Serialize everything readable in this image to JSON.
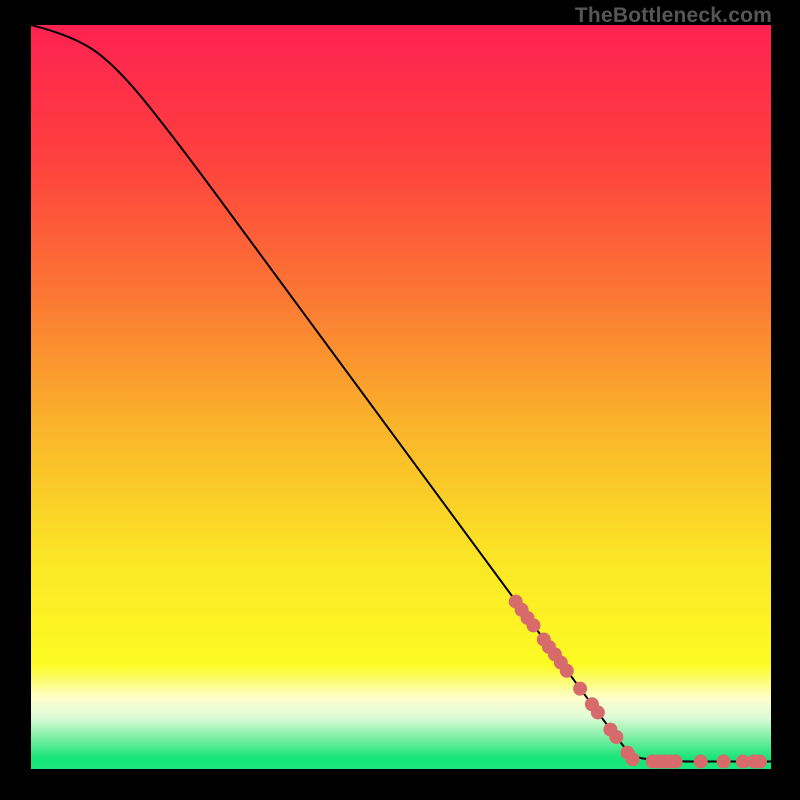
{
  "watermark": "TheBottleneck.com",
  "chart_data": {
    "type": "line",
    "title": "",
    "xlabel": "",
    "ylabel": "",
    "xlim": [
      0,
      100
    ],
    "ylim": [
      0,
      100
    ],
    "grid": false,
    "legend": false,
    "curve": [
      {
        "x": 0,
        "y": 100
      },
      {
        "x": 6,
        "y": 98.5
      },
      {
        "x": 12,
        "y": 94
      },
      {
        "x": 20,
        "y": 84
      },
      {
        "x": 30,
        "y": 70.5
      },
      {
        "x": 40,
        "y": 57
      },
      {
        "x": 50,
        "y": 43.5
      },
      {
        "x": 60,
        "y": 30
      },
      {
        "x": 70,
        "y": 16.5
      },
      {
        "x": 80,
        "y": 3
      },
      {
        "x": 82,
        "y": 1
      },
      {
        "x": 100,
        "y": 1
      }
    ],
    "markers": {
      "color": "#d76a6a",
      "radius_px": 7,
      "points": [
        {
          "x": 65.5,
          "y": 22.5
        },
        {
          "x": 66.3,
          "y": 21.4
        },
        {
          "x": 67.1,
          "y": 20.3
        },
        {
          "x": 67.9,
          "y": 19.3
        },
        {
          "x": 69.3,
          "y": 17.4
        },
        {
          "x": 70.0,
          "y": 16.4
        },
        {
          "x": 70.8,
          "y": 15.4
        },
        {
          "x": 71.6,
          "y": 14.3
        },
        {
          "x": 72.4,
          "y": 13.2
        },
        {
          "x": 74.2,
          "y": 10.8
        },
        {
          "x": 75.8,
          "y": 8.7
        },
        {
          "x": 76.6,
          "y": 7.6
        },
        {
          "x": 78.3,
          "y": 5.3
        },
        {
          "x": 79.1,
          "y": 4.3
        },
        {
          "x": 80.6,
          "y": 2.2
        },
        {
          "x": 81.3,
          "y": 1.3
        },
        {
          "x": 84.0,
          "y": 1.0
        },
        {
          "x": 84.8,
          "y": 1.0
        },
        {
          "x": 85.6,
          "y": 1.0
        },
        {
          "x": 86.4,
          "y": 1.0
        },
        {
          "x": 87.1,
          "y": 1.0
        },
        {
          "x": 90.5,
          "y": 1.0
        },
        {
          "x": 93.6,
          "y": 1.0
        },
        {
          "x": 96.2,
          "y": 1.0
        },
        {
          "x": 97.7,
          "y": 1.0
        },
        {
          "x": 98.5,
          "y": 1.0
        }
      ]
    },
    "background_gradient": {
      "stops": [
        {
          "offset": 0.0,
          "color": "#fe2251"
        },
        {
          "offset": 0.18,
          "color": "#fe403e"
        },
        {
          "offset": 0.36,
          "color": "#fb7634"
        },
        {
          "offset": 0.54,
          "color": "#fab42a"
        },
        {
          "offset": 0.72,
          "color": "#fbe626"
        },
        {
          "offset": 0.86,
          "color": "#fcfb23"
        },
        {
          "offset": 0.905,
          "color": "#fefecd"
        },
        {
          "offset": 0.93,
          "color": "#dffbd8"
        },
        {
          "offset": 0.955,
          "color": "#88f1aa"
        },
        {
          "offset": 0.985,
          "color": "#18e578"
        },
        {
          "offset": 1.0,
          "color": "#19e578"
        }
      ]
    }
  }
}
